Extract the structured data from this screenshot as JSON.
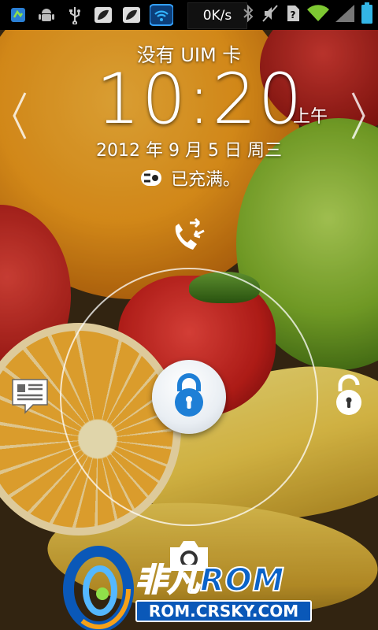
{
  "statusbar": {
    "left_icons": [
      "android-update-icon",
      "android-debug-icon",
      "usb-icon",
      "leaf-icon",
      "leaf-icon",
      "wifi-hotspot-icon"
    ],
    "net_speed": "0K/s",
    "right_icons": [
      "bluetooth-icon",
      "mute-icon",
      "no-sim-icon",
      "wifi-signal-icon",
      "cell-signal-icon",
      "battery-icon"
    ]
  },
  "lockscreen": {
    "carrier": "没有 UIM 卡",
    "time": "10:20",
    "ampm": "上午",
    "date": "2012 年 9 月 5 日 周三",
    "charging_status": "已充满。"
  },
  "unlock_targets": {
    "top": "missed-call-icon",
    "left": "message-icon",
    "right": "unlock-icon",
    "bottom": "camera-icon",
    "center": "lock-icon"
  },
  "watermark": {
    "brand": "非凡ROM",
    "url": "ROM.CRSKY.COM"
  },
  "colors": {
    "lock_blue": "#1e7fd6",
    "statusbar_bg": "#000000",
    "wifi_green": "#7ec832",
    "battery_teal": "#33b5e5"
  }
}
